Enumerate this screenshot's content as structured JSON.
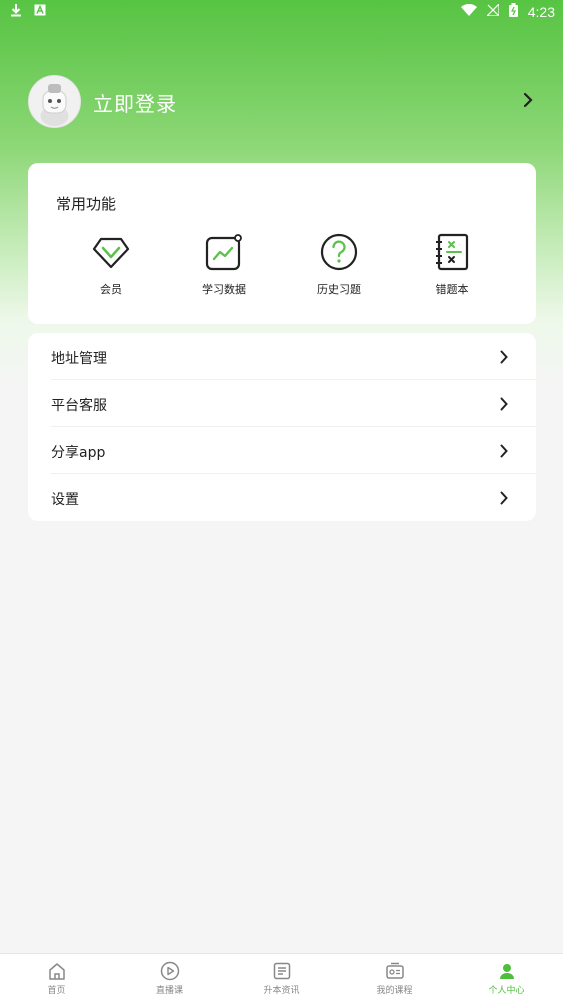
{
  "status_bar": {
    "time": "4:23"
  },
  "profile": {
    "login_text": "立即登录"
  },
  "common_functions": {
    "title": "常用功能",
    "items": [
      {
        "label": "会员",
        "icon": "vip-diamond-icon"
      },
      {
        "label": "学习数据",
        "icon": "study-data-icon"
      },
      {
        "label": "历史习题",
        "icon": "question-history-icon"
      },
      {
        "label": "错题本",
        "icon": "wrong-questions-book-icon"
      }
    ]
  },
  "menu": {
    "items": [
      {
        "label": "地址管理"
      },
      {
        "label": "平台客服"
      },
      {
        "label": "分享app"
      },
      {
        "label": "设置"
      }
    ]
  },
  "tab_bar": {
    "items": [
      {
        "label": "首页",
        "icon": "home-icon"
      },
      {
        "label": "直播课",
        "icon": "play-icon"
      },
      {
        "label": "升本资讯",
        "icon": "news-icon"
      },
      {
        "label": "我的课程",
        "icon": "courses-icon"
      },
      {
        "label": "个人中心",
        "icon": "person-icon",
        "active": true
      }
    ]
  },
  "colors": {
    "brand_green": "#57c443",
    "active_tab": "#4fbe3c"
  }
}
